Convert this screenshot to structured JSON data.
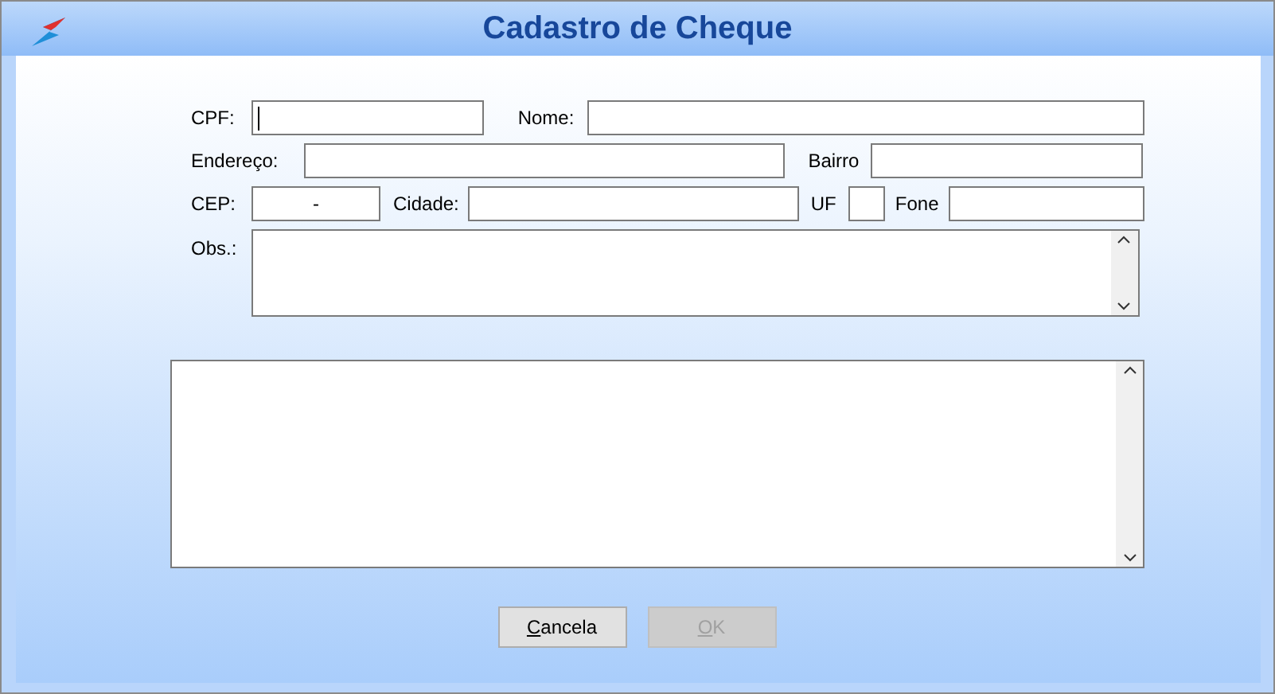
{
  "window": {
    "title": "Cadastro de Cheque"
  },
  "fields": [
    {
      "label": "CPF:",
      "focused": true
    },
    {
      "label": "Nome:"
    },
    {
      "label": "Endereço:"
    },
    {
      "label": "Bairro"
    },
    {
      "label": "CEP:",
      "value": "-"
    },
    {
      "label": "Cidade:"
    },
    {
      "label": "UF"
    },
    {
      "label": "Fone"
    }
  ],
  "obs": {
    "label": "Obs.:"
  },
  "buttons": [
    {
      "label": "Cancela",
      "disabled": false
    },
    {
      "label": "OK",
      "disabled": true
    }
  ]
}
